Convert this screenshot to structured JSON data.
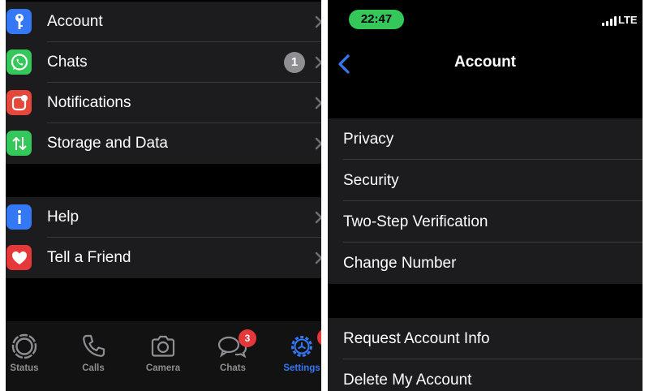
{
  "left": {
    "group1": [
      {
        "label": "Account",
        "icon": "key-icon",
        "color": "#3478f6"
      },
      {
        "label": "Chats",
        "icon": "whatsapp-icon",
        "color": "#34c759",
        "badge": "1"
      },
      {
        "label": "Notifications",
        "icon": "notifications-icon",
        "color": "#e5483b"
      },
      {
        "label": "Storage and Data",
        "icon": "storage-arrows-icon",
        "color": "#34c759"
      }
    ],
    "group2": [
      {
        "label": "Help",
        "icon": "info-icon",
        "color": "#3478f6"
      },
      {
        "label": "Tell a Friend",
        "icon": "heart-icon",
        "color": "#e5383b"
      }
    ],
    "tabs": [
      {
        "label": "Status",
        "icon": "status-icon"
      },
      {
        "label": "Calls",
        "icon": "phone-icon"
      },
      {
        "label": "Camera",
        "icon": "camera-icon"
      },
      {
        "label": "Chats",
        "icon": "chats-icon",
        "badge": "3"
      },
      {
        "label": "Settings",
        "icon": "settings-gear-icon",
        "active": true
      }
    ]
  },
  "right": {
    "status": {
      "time": "22:47",
      "network": "LTE"
    },
    "nav": {
      "title": "Account"
    },
    "group1": [
      "Privacy",
      "Security",
      "Two-Step Verification",
      "Change Number"
    ],
    "group2": [
      "Request Account Info",
      "Delete My Account"
    ]
  },
  "colors": {
    "background": "#000000",
    "cell": "#1c1c1e",
    "separator": "#38383a",
    "accent": "#3478f6",
    "badge": "#8e8e93",
    "tab_badge": "#e5383b",
    "time_pill": "#34c759"
  }
}
